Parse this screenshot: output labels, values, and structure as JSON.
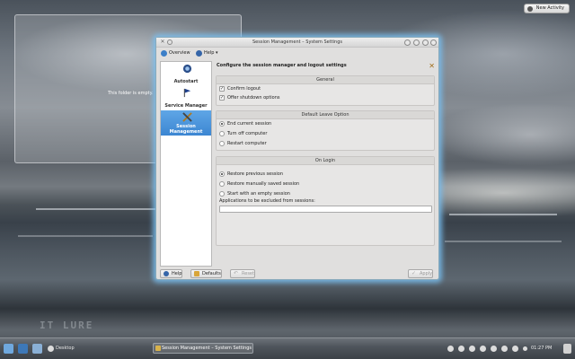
{
  "desktop": {
    "new_activity_label": "New Activity",
    "folder_view_empty_text": "This folder is empty.",
    "watermark": "IT LURE"
  },
  "window": {
    "title": "Session Management – System Settings",
    "toolbar": {
      "overview_label": "Overview",
      "help_label": "Help"
    },
    "sidebar": {
      "items": [
        {
          "label": "Autostart",
          "icon": "autostart-icon",
          "active": false
        },
        {
          "label": "Service Manager",
          "icon": "service-manager-flag-icon",
          "active": false
        },
        {
          "label": "Session\nManagement",
          "line1": "Session",
          "line2": "Management",
          "icon": "session-management-tools-icon",
          "active": true
        }
      ]
    },
    "page_title": "Configure the session manager and logout settings",
    "general": {
      "header": "General",
      "confirm_logout": {
        "label": "Confirm logout",
        "checked": true
      },
      "offer_shutdown": {
        "label": "Offer shutdown options",
        "checked": true
      }
    },
    "default_leave": {
      "header": "Default Leave Option",
      "options": [
        {
          "label": "End current session",
          "selected": true
        },
        {
          "label": "Turn off computer",
          "selected": false
        },
        {
          "label": "Restart computer",
          "selected": false
        }
      ]
    },
    "on_login": {
      "header": "On Login",
      "options": [
        {
          "label": "Restore previous session",
          "selected": true
        },
        {
          "label": "Restore manually saved session",
          "selected": false
        },
        {
          "label": "Start with an empty session",
          "selected": false
        }
      ],
      "exclude_label": "Applications to be excluded from sessions:",
      "exclude_value": ""
    },
    "buttons": {
      "help": "Help",
      "defaults": "Defaults",
      "reset": "Reset",
      "apply": "Apply"
    }
  },
  "taskbar": {
    "activity_label": "Desktop",
    "task_label": "Session Management – System Settings",
    "clock": "01:27 PM"
  },
  "colors": {
    "selection": "#3c86d2",
    "window_glow": "#78bef0",
    "window_bg": "#e0dfde"
  }
}
